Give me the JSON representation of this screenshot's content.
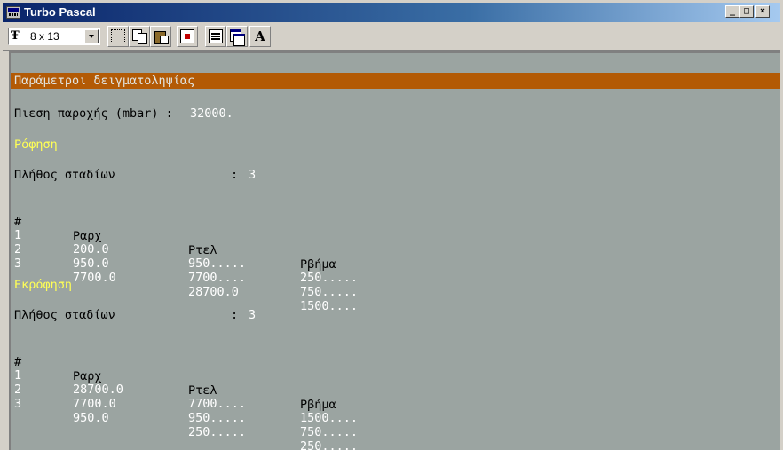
{
  "window": {
    "title": "Turbo Pascal"
  },
  "toolbar": {
    "font_value": "8 x 13",
    "font_icon": "Ŧ",
    "font_button_glyph": "A",
    "icons": [
      "truetype-font-icon",
      "mark-icon",
      "copy-icon",
      "paste-icon",
      "fullscreen-icon",
      "properties-icon",
      "background-icon",
      "font-icon"
    ]
  },
  "console": {
    "header": "Παράμετροι δειγματοληψίας",
    "pressure_label": "Πιεση παροχής (mbar) :",
    "pressure_value": "32000.",
    "sections": [
      {
        "title": "Ρόφηση",
        "count_label": "Πλήθος σταδίων",
        "count_colon": ":",
        "count_value": "3",
        "columns": [
          "#",
          "Ραρχ",
          "Ρτελ",
          "Ρβήμα"
        ],
        "rows": [
          [
            "1",
            "200.0",
            "950.....",
            "250....."
          ],
          [
            "2",
            "950.0",
            "7700....",
            "750....."
          ],
          [
            "3",
            "7700.0",
            "28700.0",
            "1500...."
          ]
        ]
      },
      {
        "title": "Εκρόφηση",
        "count_label": "Πλήθος σταδίων",
        "count_colon": ":",
        "count_value": "3",
        "columns": [
          "#",
          "Ραρχ",
          "Ρτελ",
          "Ρβήμα"
        ],
        "rows": [
          [
            "1",
            "28700.0",
            "7700....",
            "1500...."
          ],
          [
            "2",
            "7700.0",
            "950.....",
            "750....."
          ],
          [
            "3",
            "950.0",
            "250.....",
            "250....."
          ]
        ]
      }
    ]
  },
  "colors": {
    "console_bg": "#9ba4a1",
    "header_bar": "#b35a05",
    "section_title": "#ffff55",
    "value_text": "#ffffff",
    "label_text": "#000000"
  }
}
